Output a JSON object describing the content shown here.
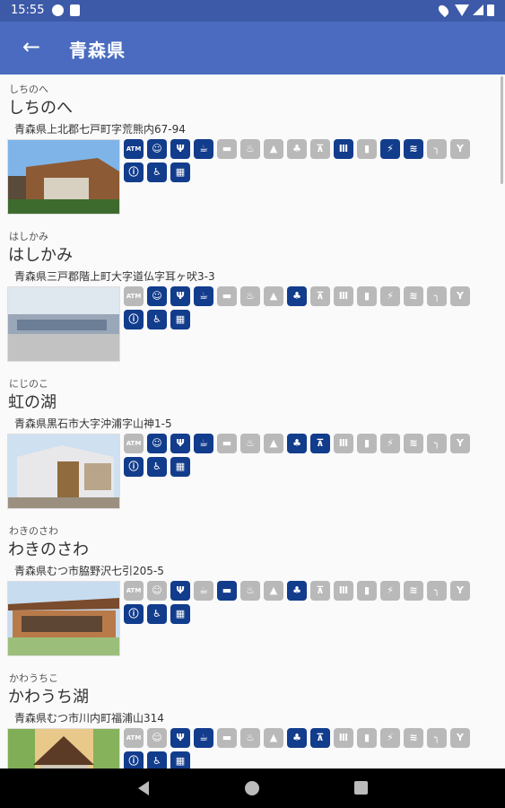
{
  "status_bar": {
    "time": "15:55"
  },
  "app_bar": {
    "title": "青森県",
    "back_icon": "arrow-left-icon"
  },
  "facility_icons": [
    {
      "key": "atm",
      "glyph": "ATM",
      "icon": "atm-icon"
    },
    {
      "key": "baby",
      "glyph": "☺",
      "icon": "baby-room-icon"
    },
    {
      "key": "restaurant",
      "glyph": "Ψ",
      "icon": "restaurant-icon"
    },
    {
      "key": "cafe",
      "glyph": "☕",
      "icon": "cafe-icon"
    },
    {
      "key": "lodging",
      "glyph": "▬",
      "icon": "lodging-icon"
    },
    {
      "key": "onsen",
      "glyph": "♨",
      "icon": "hot-spring-icon"
    },
    {
      "key": "camp",
      "glyph": "▲",
      "icon": "campsite-icon"
    },
    {
      "key": "park",
      "glyph": "♣",
      "icon": "park-icon"
    },
    {
      "key": "view",
      "glyph": "⊼",
      "icon": "observatory-icon"
    },
    {
      "key": "museum",
      "glyph": "Ⅲ",
      "icon": "museum-icon"
    },
    {
      "key": "gas",
      "glyph": "▮",
      "icon": "gas-station-icon"
    },
    {
      "key": "ev",
      "glyph": "⚡",
      "icon": "ev-charger-icon"
    },
    {
      "key": "wifi",
      "glyph": "≋",
      "icon": "wifi-icon"
    },
    {
      "key": "shower",
      "glyph": "╮",
      "icon": "shower-icon"
    },
    {
      "key": "bike",
      "glyph": "Y",
      "icon": "bicycle-icon"
    },
    {
      "key": "info",
      "glyph": "ⓘ",
      "icon": "information-icon"
    },
    {
      "key": "barrier",
      "glyph": "♿",
      "icon": "wheelchair-icon"
    },
    {
      "key": "shop",
      "glyph": "▦",
      "icon": "shop-icon"
    }
  ],
  "stations": [
    {
      "kana": "しちのへ",
      "name": "しちのへ",
      "address": "青森県上北郡七戸町字荒熊内67-94",
      "available": [
        1,
        1,
        1,
        1,
        0,
        0,
        0,
        0,
        0,
        1,
        0,
        1,
        1,
        0,
        0,
        1,
        1,
        1
      ]
    },
    {
      "kana": "はしかみ",
      "name": "はしかみ",
      "address": "青森県三戸郡階上町大字道仏字耳ヶ吠3-3",
      "available": [
        0,
        1,
        1,
        1,
        0,
        0,
        0,
        1,
        0,
        0,
        0,
        0,
        0,
        0,
        0,
        1,
        1,
        1
      ]
    },
    {
      "kana": "にじのこ",
      "name": "虹の湖",
      "address": "青森県黒石市大字沖浦字山神1-5",
      "available": [
        0,
        1,
        1,
        1,
        0,
        0,
        0,
        1,
        1,
        0,
        0,
        0,
        0,
        0,
        0,
        1,
        1,
        1
      ]
    },
    {
      "kana": "わきのさわ",
      "name": "わきのさわ",
      "address": "青森県むつ市脇野沢七引205-5",
      "available": [
        0,
        0,
        1,
        0,
        1,
        0,
        0,
        1,
        0,
        0,
        0,
        0,
        0,
        0,
        0,
        1,
        1,
        1
      ]
    },
    {
      "kana": "かわうちこ",
      "name": "かわうち湖",
      "address": "青森県むつ市川内町福浦山314",
      "available": [
        0,
        0,
        1,
        1,
        0,
        0,
        0,
        1,
        1,
        0,
        0,
        0,
        0,
        0,
        0,
        1,
        1,
        1
      ]
    }
  ]
}
